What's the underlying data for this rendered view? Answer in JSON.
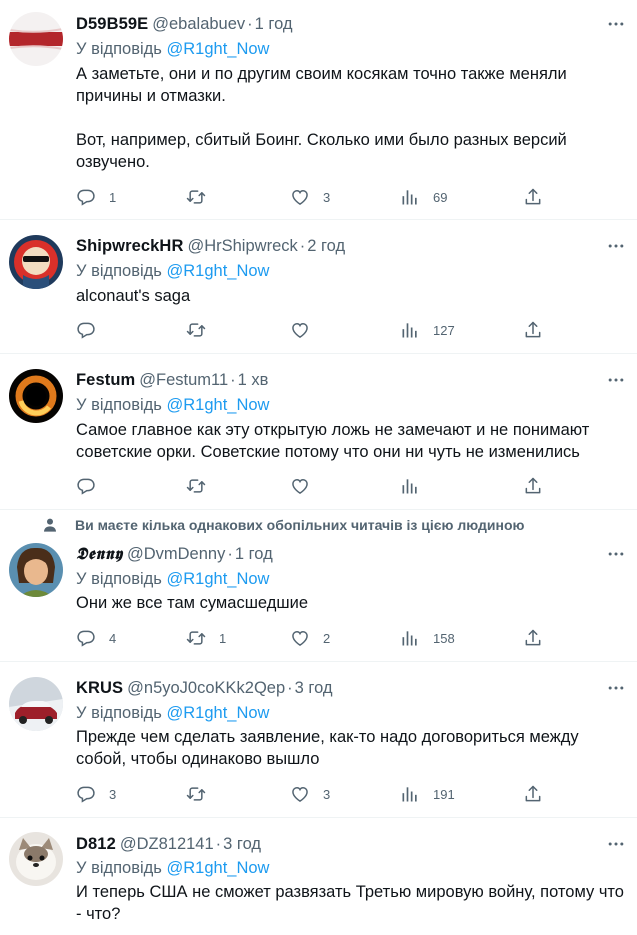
{
  "reply_prefix": "У відповідь",
  "tweets": [
    {
      "name": "D59B59E",
      "handle": "@ebalabuev",
      "time": "1 год",
      "mention": "@R1ght_Now",
      "text": "А заметьте, они и по другим своим косякам точно также меняли причины и отмазки.\n\nВот, например, сбитый Боинг. Сколько ими было разных версий озвучено.",
      "replies": "1",
      "retweets": "",
      "likes": "3",
      "views": "69",
      "avatar_icon": "white-red-white-flag-avatar"
    },
    {
      "name": "ShipwreckHR",
      "handle": "@HrShipwreck",
      "time": "2 год",
      "mention": "@R1ght_Now",
      "text": "alconaut's saga",
      "replies": "",
      "retweets": "",
      "likes": "",
      "views": "127",
      "avatar_icon": "sunglasses-portrait-avatar"
    },
    {
      "name": "Festum",
      "handle": "@Festum11",
      "time": "1 хв",
      "mention": "@R1ght_Now",
      "text": "Самое главное как эту открытую ложь не замечают и не понимают советские орки. Советские потому что они ни чуть не изменились",
      "replies": "",
      "retweets": "",
      "likes": "",
      "views": "",
      "avatar_icon": "black-hole-avatar"
    },
    {
      "social_context": "Ви маєте кілька однакових обопільних читачів із цією людиною",
      "name": "𝕯𝖊𝖓𝖓𝖞",
      "handle": "@DvmDenny",
      "time": "1 год",
      "mention": "@R1ght_Now",
      "text": "Они же все там сумасшедшие",
      "replies": "4",
      "retweets": "1",
      "likes": "2",
      "views": "158",
      "avatar_icon": "cartoon-character-avatar"
    },
    {
      "name": "KRUS",
      "handle": "@n5yoJ0coKKk2Qep",
      "time": "3 год",
      "mention": "@R1ght_Now",
      "text": "Прежде чем сделать заявление, как-то надо договориться между собой, чтобы одинаково вышло",
      "replies": "3",
      "retweets": "",
      "likes": "3",
      "views": "191",
      "avatar_icon": "snowy-car-avatar"
    },
    {
      "name": "D812",
      "handle": "@DZ812141",
      "time": "3 год",
      "mention": "@R1ght_Now",
      "text": "И теперь США не сможет развязать Третью мировую войну, потому что - что?",
      "avatar_icon": "fluffy-dog-avatar"
    }
  ]
}
